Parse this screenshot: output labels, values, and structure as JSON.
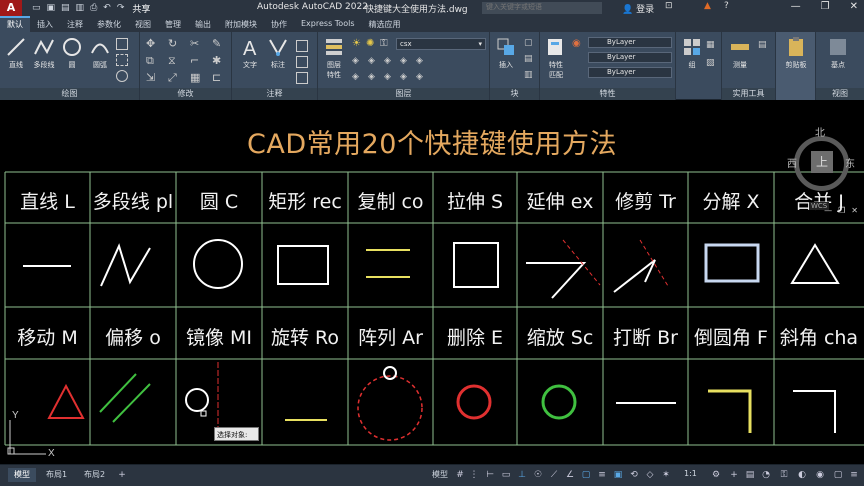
{
  "titlebar": {
    "app_title": "Autodesk AutoCAD 2022",
    "file_title": "快捷键大全使用方法.dwg",
    "share_label": "共享",
    "search_placeholder": "键入关键字或短语",
    "user_label": "登录"
  },
  "ribbon_tabs": [
    "默认",
    "插入",
    "注释",
    "参数化",
    "视图",
    "管理",
    "输出",
    "附加模块",
    "协作",
    "Express Tools",
    "精选应用"
  ],
  "ribbon": {
    "draw_buttons": [
      "直线",
      "多段线",
      "圆",
      "圆弧"
    ],
    "draw_group": "绘图",
    "modify_group": "修改",
    "text_button": "文字",
    "dim_button": "标注",
    "annotate_group": "注释",
    "layer_props_button": "图层\n特性",
    "layer_name": "csx",
    "layer_group": "图层",
    "insert_button": "插入",
    "block_group": "块",
    "match_button": "特性\n匹配",
    "bylayer": [
      "ByLayer",
      "ByLayer",
      "ByLayer"
    ],
    "props_group": "特性",
    "group_button": "组",
    "measure_button": "测量",
    "utilities_group": "实用工具",
    "clipboard_button": "剪贴板",
    "base_button": "基点",
    "view_group": "视图"
  },
  "drawing": {
    "title": "CAD常用20个快捷键使用方法",
    "row1": [
      "直线 L",
      "多段线 pl",
      "圆 C",
      "矩形 rec",
      "复制 co",
      "拉伸 S",
      "延伸 ex",
      "修剪 Tr",
      "分解 X",
      "合并 J"
    ],
    "row2": [
      "移动 M",
      "偏移 o",
      "镜像 MI",
      "旋转 Ro",
      "阵列 Ar",
      "删除 E",
      "缩放 Sc",
      "打断 Br",
      "倒圆角 F",
      "斜角 cha"
    ],
    "tooltip": "选择对象:"
  },
  "viewcube": {
    "north": "北",
    "west": "西",
    "east": "东",
    "face": "上",
    "wcs": "WCS"
  },
  "ucs": {
    "x": "X",
    "y": "Y"
  },
  "statusbar": {
    "layouts": [
      "模型",
      "布局1",
      "布局2"
    ],
    "model_label": "模型",
    "scale": "1:1"
  },
  "colors": {
    "title": "#e4a85f",
    "grid": "#8fbf8f",
    "red": "#e03030",
    "green": "#40c040",
    "yellow": "#e8e060",
    "accent": "#58a8e6"
  }
}
